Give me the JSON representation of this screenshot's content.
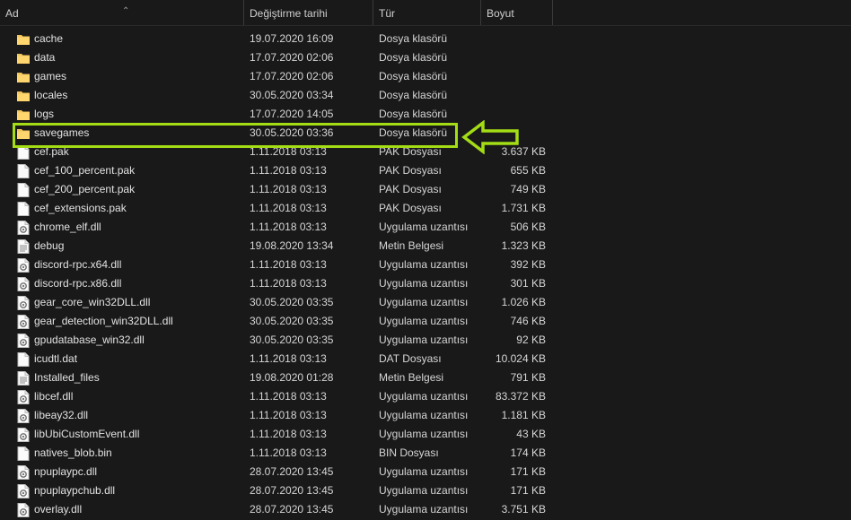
{
  "columns": {
    "name": "Ad",
    "date": "Değiştirme tarihi",
    "type": "Tür",
    "size": "Boyut"
  },
  "accent_color": "#a4dc16",
  "files": [
    {
      "name": "cache",
      "date": "19.07.2020 16:09",
      "type": "Dosya klasörü",
      "size": "",
      "icon": "folder-icon"
    },
    {
      "name": "data",
      "date": "17.07.2020 02:06",
      "type": "Dosya klasörü",
      "size": "",
      "icon": "folder-icon"
    },
    {
      "name": "games",
      "date": "17.07.2020 02:06",
      "type": "Dosya klasörü",
      "size": "",
      "icon": "folder-icon"
    },
    {
      "name": "locales",
      "date": "30.05.2020 03:34",
      "type": "Dosya klasörü",
      "size": "",
      "icon": "folder-icon"
    },
    {
      "name": "logs",
      "date": "17.07.2020 14:05",
      "type": "Dosya klasörü",
      "size": "",
      "icon": "folder-icon"
    },
    {
      "name": "savegames",
      "date": "30.05.2020 03:36",
      "type": "Dosya klasörü",
      "size": "",
      "icon": "folder-icon"
    },
    {
      "name": "cef.pak",
      "date": "1.11.2018 03:13",
      "type": "PAK Dosyası",
      "size": "3.637 KB",
      "icon": "file-icon"
    },
    {
      "name": "cef_100_percent.pak",
      "date": "1.11.2018 03:13",
      "type": "PAK Dosyası",
      "size": "655 KB",
      "icon": "file-icon"
    },
    {
      "name": "cef_200_percent.pak",
      "date": "1.11.2018 03:13",
      "type": "PAK Dosyası",
      "size": "749 KB",
      "icon": "file-icon"
    },
    {
      "name": "cef_extensions.pak",
      "date": "1.11.2018 03:13",
      "type": "PAK Dosyası",
      "size": "1.731 KB",
      "icon": "file-icon"
    },
    {
      "name": "chrome_elf.dll",
      "date": "1.11.2018 03:13",
      "type": "Uygulama uzantısı",
      "size": "506 KB",
      "icon": "dll-icon"
    },
    {
      "name": "debug",
      "date": "19.08.2020 13:34",
      "type": "Metin Belgesi",
      "size": "1.323 KB",
      "icon": "text-file-icon"
    },
    {
      "name": "discord-rpc.x64.dll",
      "date": "1.11.2018 03:13",
      "type": "Uygulama uzantısı",
      "size": "392 KB",
      "icon": "dll-icon"
    },
    {
      "name": "discord-rpc.x86.dll",
      "date": "1.11.2018 03:13",
      "type": "Uygulama uzantısı",
      "size": "301 KB",
      "icon": "dll-icon"
    },
    {
      "name": "gear_core_win32DLL.dll",
      "date": "30.05.2020 03:35",
      "type": "Uygulama uzantısı",
      "size": "1.026 KB",
      "icon": "dll-icon"
    },
    {
      "name": "gear_detection_win32DLL.dll",
      "date": "30.05.2020 03:35",
      "type": "Uygulama uzantısı",
      "size": "746 KB",
      "icon": "dll-icon"
    },
    {
      "name": "gpudatabase_win32.dll",
      "date": "30.05.2020 03:35",
      "type": "Uygulama uzantısı",
      "size": "92 KB",
      "icon": "dll-icon"
    },
    {
      "name": "icudtl.dat",
      "date": "1.11.2018 03:13",
      "type": "DAT Dosyası",
      "size": "10.024 KB",
      "icon": "file-icon"
    },
    {
      "name": "Installed_files",
      "date": "19.08.2020 01:28",
      "type": "Metin Belgesi",
      "size": "791 KB",
      "icon": "text-file-icon"
    },
    {
      "name": "libcef.dll",
      "date": "1.11.2018 03:13",
      "type": "Uygulama uzantısı",
      "size": "83.372 KB",
      "icon": "dll-icon"
    },
    {
      "name": "libeay32.dll",
      "date": "1.11.2018 03:13",
      "type": "Uygulama uzantısı",
      "size": "1.181 KB",
      "icon": "dll-icon"
    },
    {
      "name": "libUbiCustomEvent.dll",
      "date": "1.11.2018 03:13",
      "type": "Uygulama uzantısı",
      "size": "43 KB",
      "icon": "dll-icon"
    },
    {
      "name": "natives_blob.bin",
      "date": "1.11.2018 03:13",
      "type": "BIN Dosyası",
      "size": "174 KB",
      "icon": "file-icon"
    },
    {
      "name": "npuplaypc.dll",
      "date": "28.07.2020 13:45",
      "type": "Uygulama uzantısı",
      "size": "171 KB",
      "icon": "dll-icon"
    },
    {
      "name": "npuplaypchub.dll",
      "date": "28.07.2020 13:45",
      "type": "Uygulama uzantısı",
      "size": "171 KB",
      "icon": "dll-icon"
    },
    {
      "name": "overlay.dll",
      "date": "28.07.2020 13:45",
      "type": "Uygulama uzantısı",
      "size": "3.751 KB",
      "icon": "dll-icon"
    }
  ]
}
